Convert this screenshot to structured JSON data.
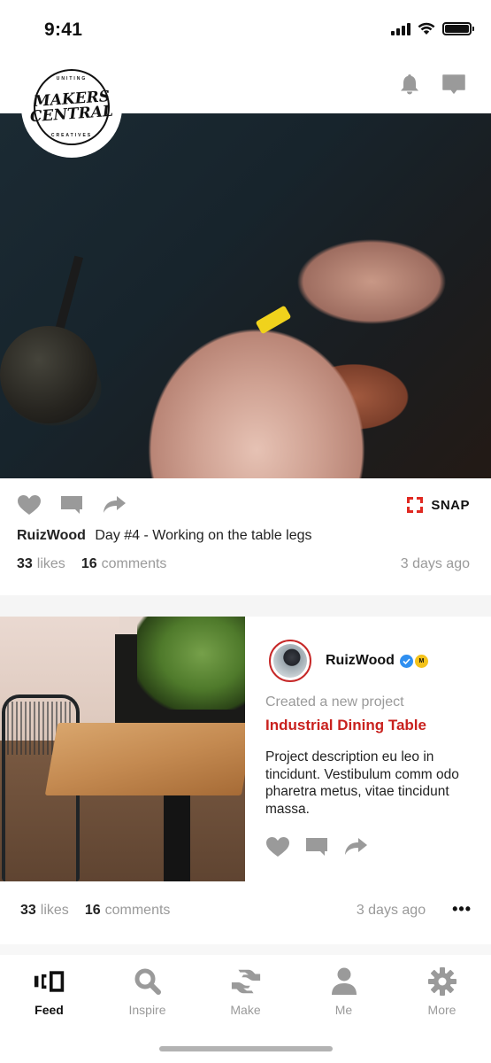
{
  "status_bar": {
    "time": "9:41"
  },
  "header": {
    "logo": {
      "top_text": "UNITING",
      "line1": "MAKERS",
      "line2": "CENTRAL",
      "bottom_text": "CREATIVES"
    },
    "icons": [
      "bell-icon",
      "message-icon"
    ]
  },
  "post1": {
    "image_alt": "Hands carving wood with a yellow-handled knife",
    "actions": [
      "heart-icon",
      "comment-icon",
      "share-icon"
    ],
    "snap_label": "SNAP",
    "snap_color": "#e02a22",
    "caption_user": "RuizWood",
    "caption_text": "Day #4 - Working on the table legs",
    "likes_count": "33",
    "likes_label": "likes",
    "comments_count": "16",
    "comments_label": "comments",
    "time_ago": "3 days ago"
  },
  "post2": {
    "image_alt": "Wooden dining table with black chair and plants",
    "author_name": "RuizWood",
    "verified_color": "#2f8ff0",
    "maker_badge": "M",
    "subtitle": "Created a new project",
    "project_title": "Industrial Dining Table",
    "project_title_color": "#c9211e",
    "description": "Project description eu leo in tincidunt. Vestibulum comm odo pharetra metus, vitae tincidunt massa.",
    "actions": [
      "heart-icon",
      "comment-icon",
      "share-icon"
    ],
    "likes_count": "33",
    "likes_label": "likes",
    "comments_count": "16",
    "comments_label": "comments",
    "time_ago": "3 days ago",
    "more_label": "•••"
  },
  "tab_bar": {
    "active": "Feed",
    "tabs": [
      {
        "label": "Feed",
        "icon": "feed-icon"
      },
      {
        "label": "Inspire",
        "icon": "search-icon"
      },
      {
        "label": "Make",
        "icon": "make-hands-icon"
      },
      {
        "label": "Me",
        "icon": "person-icon"
      },
      {
        "label": "More",
        "icon": "gear-icon"
      }
    ]
  }
}
